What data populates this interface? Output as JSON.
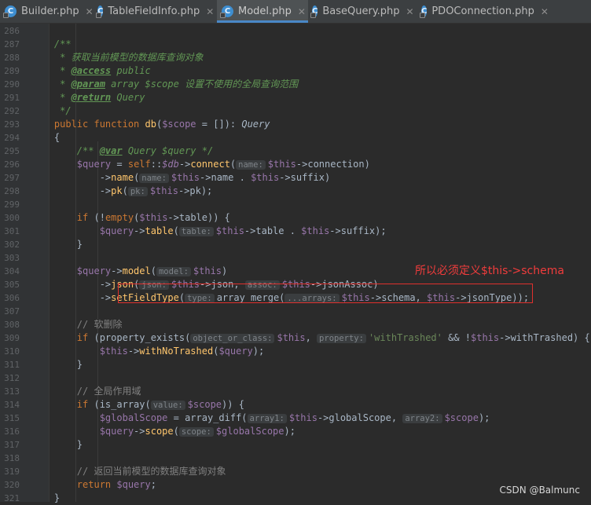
{
  "tabs": [
    {
      "label": "Builder.php",
      "active": false
    },
    {
      "label": "TableFieldInfo.php",
      "active": false
    },
    {
      "label": "Model.php",
      "active": true
    },
    {
      "label": "BaseQuery.php",
      "active": false
    },
    {
      "label": "PDOConnection.php",
      "active": false
    }
  ],
  "annotation": "所以必须定义$this->schema",
  "watermark": "CSDN @Balmunc",
  "lines": [
    {
      "n": "286",
      "tokens": []
    },
    {
      "n": "287",
      "tokens": [
        [
          "t-cmt",
          "    /**"
        ]
      ]
    },
    {
      "n": "288",
      "tokens": [
        [
          "t-cmt",
          "     * 获取当前模型的数据库查询对象"
        ]
      ]
    },
    {
      "n": "289",
      "tokens": [
        [
          "t-cmt",
          "     * "
        ],
        [
          "t-tag",
          "@access"
        ],
        [
          "t-cmt",
          " public"
        ]
      ]
    },
    {
      "n": "290",
      "tokens": [
        [
          "t-cmt",
          "     * "
        ],
        [
          "t-tag",
          "@param"
        ],
        [
          "t-cmt",
          " array $scope 设置不使用的全局查询范围"
        ]
      ]
    },
    {
      "n": "291",
      "tokens": [
        [
          "t-cmt",
          "     * "
        ],
        [
          "t-tag",
          "@return"
        ],
        [
          "t-cmt",
          " Query"
        ]
      ]
    },
    {
      "n": "292",
      "tokens": [
        [
          "t-cmt",
          "     */"
        ]
      ]
    },
    {
      "n": "293",
      "tokens": [
        [
          "t-kw",
          "    public function "
        ],
        [
          "t-fn",
          "db"
        ],
        [
          "",
          "("
        ],
        [
          "t-var",
          "$scope"
        ],
        [
          "",
          " = []): "
        ],
        [
          "t-type",
          "Query"
        ]
      ]
    },
    {
      "n": "294",
      "tokens": [
        [
          "",
          "    {"
        ]
      ]
    },
    {
      "n": "295",
      "tokens": [
        [
          "t-cmt",
          "        /** "
        ],
        [
          "t-tag",
          "@var"
        ],
        [
          "t-cmt",
          " Query $query */"
        ]
      ]
    },
    {
      "n": "296",
      "tokens": [
        [
          "t-var",
          "        $query"
        ],
        [
          "",
          " = "
        ],
        [
          "t-kw",
          "self"
        ],
        [
          "",
          "::"
        ],
        [
          "t-ivar",
          "$db"
        ],
        [
          "",
          "->"
        ],
        [
          "t-fn",
          "connect"
        ],
        [
          "",
          "("
        ],
        [
          "hint",
          "name:"
        ],
        [
          "t-var",
          "$this"
        ],
        [
          "",
          "->connection)"
        ]
      ]
    },
    {
      "n": "297",
      "tokens": [
        [
          "",
          "            ->"
        ],
        [
          "t-fn",
          "name"
        ],
        [
          "",
          "("
        ],
        [
          "hint",
          "name:"
        ],
        [
          "t-var",
          "$this"
        ],
        [
          "",
          "->name . "
        ],
        [
          "t-var",
          "$this"
        ],
        [
          "",
          "->suffix)"
        ]
      ]
    },
    {
      "n": "298",
      "tokens": [
        [
          "",
          "            ->"
        ],
        [
          "t-fn",
          "pk"
        ],
        [
          "",
          "("
        ],
        [
          "hint",
          "pk:"
        ],
        [
          "t-var",
          "$this"
        ],
        [
          "",
          "->pk);"
        ]
      ]
    },
    {
      "n": "299",
      "tokens": []
    },
    {
      "n": "300",
      "tokens": [
        [
          "t-kw",
          "        if "
        ],
        [
          "",
          "(!"
        ],
        [
          "t-kw",
          "empty"
        ],
        [
          "",
          "("
        ],
        [
          "t-var",
          "$this"
        ],
        [
          "",
          "->table)) {"
        ]
      ]
    },
    {
      "n": "301",
      "tokens": [
        [
          "t-var",
          "            $query"
        ],
        [
          "",
          "->"
        ],
        [
          "t-fn",
          "table"
        ],
        [
          "",
          "("
        ],
        [
          "hint",
          "table:"
        ],
        [
          "t-var",
          "$this"
        ],
        [
          "",
          "->table . "
        ],
        [
          "t-var",
          "$this"
        ],
        [
          "",
          "->suffix);"
        ]
      ]
    },
    {
      "n": "302",
      "tokens": [
        [
          "",
          "        }"
        ]
      ]
    },
    {
      "n": "303",
      "tokens": []
    },
    {
      "n": "304",
      "tokens": [
        [
          "t-var",
          "        $query"
        ],
        [
          "",
          "->"
        ],
        [
          "t-fn",
          "model"
        ],
        [
          "",
          "("
        ],
        [
          "hint",
          "model:"
        ],
        [
          "t-var",
          "$this"
        ],
        [
          "",
          ")"
        ]
      ]
    },
    {
      "n": "305",
      "tokens": [
        [
          "",
          "            ->"
        ],
        [
          "t-fn",
          "json"
        ],
        [
          "",
          "("
        ],
        [
          "hint",
          "json:"
        ],
        [
          "t-var",
          "$this"
        ],
        [
          "",
          "->json, "
        ],
        [
          "hint",
          "assoc:"
        ],
        [
          "t-var",
          "$this"
        ],
        [
          "",
          "->jsonAssoc)"
        ]
      ]
    },
    {
      "n": "306",
      "tokens": [
        [
          "",
          "            ->"
        ],
        [
          "t-fn",
          "setFieldType"
        ],
        [
          "",
          "("
        ],
        [
          "hint",
          "type:"
        ],
        [
          "",
          "array_merge("
        ],
        [
          "hint",
          "...arrays:"
        ],
        [
          "t-var",
          "$this"
        ],
        [
          "",
          "->schema, "
        ],
        [
          "t-var",
          "$this"
        ],
        [
          "",
          "->jsonType));"
        ]
      ]
    },
    {
      "n": "307",
      "tokens": []
    },
    {
      "n": "308",
      "tokens": [
        [
          "t-ccmt",
          "        // 软删除"
        ]
      ]
    },
    {
      "n": "309",
      "tokens": [
        [
          "t-kw",
          "        if "
        ],
        [
          "",
          "(property_exists("
        ],
        [
          "hint",
          "object_or_class:"
        ],
        [
          "t-var",
          "$this"
        ],
        [
          "",
          ", "
        ],
        [
          "hint",
          "property:"
        ],
        [
          "t-str",
          "'withTrashed'"
        ],
        [
          "",
          " && !"
        ],
        [
          "t-var",
          "$this"
        ],
        [
          "",
          "->withTrashed) {"
        ]
      ]
    },
    {
      "n": "310",
      "tokens": [
        [
          "t-var",
          "            $this"
        ],
        [
          "",
          "->"
        ],
        [
          "t-fn",
          "withNoTrashed"
        ],
        [
          "",
          "("
        ],
        [
          "t-var",
          "$query"
        ],
        [
          "",
          ");"
        ]
      ]
    },
    {
      "n": "311",
      "tokens": [
        [
          "",
          "        }"
        ]
      ]
    },
    {
      "n": "312",
      "tokens": []
    },
    {
      "n": "313",
      "tokens": [
        [
          "t-ccmt",
          "        // 全局作用域"
        ]
      ]
    },
    {
      "n": "314",
      "tokens": [
        [
          "t-kw",
          "        if "
        ],
        [
          "",
          "(is_array("
        ],
        [
          "hint",
          "value:"
        ],
        [
          "t-var",
          "$scope"
        ],
        [
          "",
          ")) {"
        ]
      ]
    },
    {
      "n": "315",
      "tokens": [
        [
          "t-var",
          "            $globalScope"
        ],
        [
          "",
          " = array_diff("
        ],
        [
          "hint",
          "array1:"
        ],
        [
          "t-var",
          "$this"
        ],
        [
          "",
          "->globalScope, "
        ],
        [
          "hint",
          "array2:"
        ],
        [
          "t-var",
          "$scope"
        ],
        [
          "",
          ");"
        ]
      ]
    },
    {
      "n": "316",
      "tokens": [
        [
          "t-var",
          "            $query"
        ],
        [
          "",
          "->"
        ],
        [
          "t-fn",
          "scope"
        ],
        [
          "",
          "("
        ],
        [
          "hint",
          "scope:"
        ],
        [
          "t-var",
          "$globalScope"
        ],
        [
          "",
          ");"
        ]
      ]
    },
    {
      "n": "317",
      "tokens": [
        [
          "",
          "        }"
        ]
      ]
    },
    {
      "n": "318",
      "tokens": []
    },
    {
      "n": "319",
      "tokens": [
        [
          "t-ccmt",
          "        // 返回当前模型的数据库查询对象"
        ]
      ]
    },
    {
      "n": "320",
      "tokens": [
        [
          "t-kw",
          "        return "
        ],
        [
          "t-var",
          "$query"
        ],
        [
          "",
          ";"
        ]
      ]
    },
    {
      "n": "321",
      "tokens": [
        [
          "",
          "    }"
        ]
      ]
    }
  ]
}
